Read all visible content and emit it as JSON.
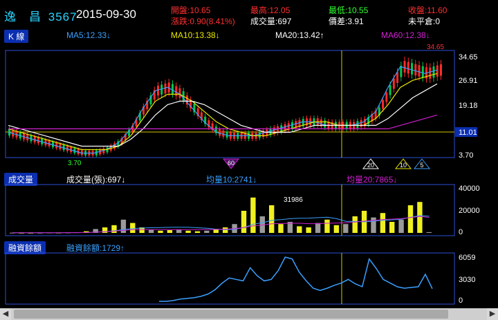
{
  "header": {
    "name": "逸　昌",
    "code": "3567",
    "date": "2015-09-30",
    "open_label": "開盤:",
    "open": "10.65",
    "high_label": "最高:",
    "high": "12.05",
    "low_label": "最低:",
    "low": "10.55",
    "close_label": "收盤:",
    "close": "11.60",
    "change_label": "漲跌:",
    "change": "0.90(8.41%)",
    "volume_label": "成交量:",
    "volume": "697",
    "spread_label": "價差:",
    "spread": "3.91",
    "unsettled_label": "未平倉:",
    "unsettled": "0"
  },
  "kline": {
    "tab": "K 線",
    "ma5": "MA5:12.33↓",
    "ma10": "MA10:13.38↓",
    "ma20": "MA20:13.42↑",
    "ma60": "MA60:12.38↓",
    "max_label": "34.65",
    "min_label": "3.70",
    "y_ticks": [
      "34.65",
      "26.91",
      "19.18",
      "11.01",
      "3.70"
    ],
    "markers": [
      "60",
      "20",
      "10",
      "5"
    ]
  },
  "volume": {
    "tab": "成交量",
    "vol": "成交量(張):697↓",
    "avg10": "均量10:2741↓",
    "avg20": "均量20:7865↓",
    "peak_label": "31986",
    "y_ticks": [
      "40000",
      "20000",
      "0"
    ]
  },
  "margin": {
    "tab": "融資餘額",
    "value": "融資餘額:1729↑",
    "y_ticks": [
      "6059",
      "3030",
      "0"
    ]
  },
  "colors": {
    "up": "#ff2b2b",
    "down": "#00c850",
    "ma5": "#3aa0ff",
    "ma10": "#e8e800",
    "ma20": "#ffffff",
    "ma60": "#d020d0",
    "border": "#2b4fd6"
  },
  "chart_data": [
    {
      "type": "line",
      "title": "K 線",
      "series": [
        {
          "name": "MA5",
          "values": [
            11,
            10,
            9,
            8,
            7,
            6,
            5,
            5,
            6,
            8,
            12,
            18,
            23,
            24,
            22,
            18,
            14,
            11,
            10,
            10,
            10,
            11,
            12,
            13,
            14,
            14,
            13,
            13,
            13,
            14,
            17,
            24,
            30,
            29,
            28,
            29
          ]
        },
        {
          "name": "MA10",
          "values": [
            12,
            11,
            10,
            9,
            8,
            7,
            6,
            6,
            6,
            7,
            10,
            15,
            20,
            22,
            22,
            20,
            17,
            14,
            12,
            11,
            10,
            10,
            11,
            12,
            13,
            14,
            14,
            13,
            13,
            13,
            15,
            19,
            24,
            26,
            27,
            28
          ]
        },
        {
          "name": "MA20",
          "values": [
            13,
            12,
            11,
            10,
            9,
            8,
            7,
            7,
            7,
            7,
            9,
            12,
            16,
            19,
            20,
            20,
            19,
            17,
            15,
            13,
            12,
            11,
            11,
            11,
            12,
            13,
            13,
            13,
            13,
            13,
            13,
            15,
            18,
            21,
            23,
            25
          ]
        },
        {
          "name": "MA60",
          "values": [
            12,
            12,
            12,
            12,
            12,
            12,
            12,
            12,
            12,
            12,
            12,
            12,
            12,
            12,
            12,
            12,
            12,
            12,
            12,
            12,
            12,
            12,
            12,
            12,
            12,
            12,
            12,
            12,
            12,
            12,
            12,
            12,
            13,
            14,
            15,
            16
          ]
        }
      ],
      "ylim": [
        3.7,
        34.65
      ]
    },
    {
      "type": "bar",
      "title": "成交量",
      "values": [
        200,
        150,
        100,
        150,
        300,
        250,
        400,
        600,
        1500,
        3500,
        5000,
        7000,
        12000,
        9000,
        5000,
        3000,
        2000,
        2500,
        3000,
        2000,
        1500,
        2000,
        3500,
        5000,
        8000,
        20000,
        31986,
        15000,
        25000,
        8000,
        10000,
        6000,
        5000,
        9000,
        12000,
        7000,
        8000,
        15000,
        20000,
        14000,
        18000,
        10000,
        12000,
        25000,
        28000,
        697
      ],
      "ylim": [
        0,
        40000
      ]
    },
    {
      "type": "line",
      "title": "融資餘額",
      "values": [
        0,
        0,
        100,
        300,
        400,
        500,
        700,
        1000,
        1600,
        2500,
        3200,
        3000,
        2800,
        4600,
        3500,
        2800,
        3000,
        4200,
        6059,
        5800,
        4000,
        2800,
        1800,
        1500,
        1800,
        2200,
        2500,
        3000,
        2400,
        2000,
        5800,
        4500,
        3000,
        2500,
        2000,
        1800,
        1900,
        2000,
        3700,
        1729
      ],
      "ylim": [
        0,
        6059
      ]
    }
  ]
}
